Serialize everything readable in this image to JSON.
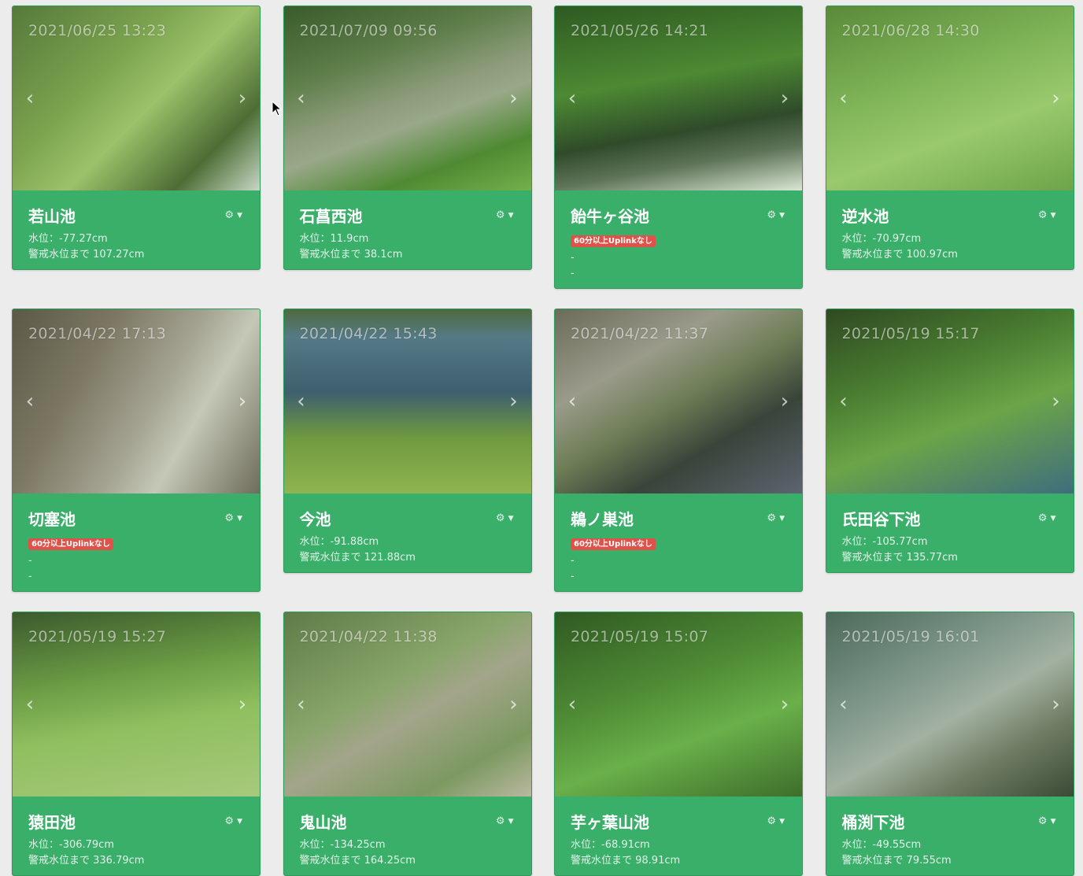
{
  "badge_text": "60分以上Uplinkなし",
  "cards": [
    {
      "name": "若山池",
      "timestamp": "2021/06/25 13:23",
      "line1": "水位：-77.27cm",
      "line2": "警戒水位まで 107.27cm",
      "badge": false,
      "bg": "linear-gradient(135deg,#557a3a 0%,#7aa24e 35%,#9cc26a 55%,#4d6d35 80%,#c7d7c5 100%)"
    },
    {
      "name": "石菖西池",
      "timestamp": "2021/07/09 09:56",
      "line1": "水位：11.9cm",
      "line2": "警戒水位まで 38.1cm",
      "badge": false,
      "bg": "linear-gradient(160deg,#385c2a 0%,#5e7e4a 30%,#8e9c7c 50%,#9aa88a 60%,#4f8a33 80%,#74b04b 100%)"
    },
    {
      "name": "飴牛ヶ谷池",
      "timestamp": "2021/05/26 14:21",
      "line1": "-",
      "line2": "-",
      "badge": true,
      "bg": "linear-gradient(170deg,#2e5a22 0%,#4d8a33 40%,#2f4b2a 65%,#5f7458 80%,#d9e6d4 100%)"
    },
    {
      "name": "逆水池",
      "timestamp": "2021/06/28 14:30",
      "line1": "水位：-70.97cm",
      "line2": "警戒水位まで 100.97cm",
      "badge": false,
      "bg": "linear-gradient(160deg,#5a8a3a 0%,#7fb457 40%,#9ac96d 65%,#6da449 100%)"
    },
    {
      "name": "切塞池",
      "timestamp": "2021/04/22 17:13",
      "line1": "-",
      "line2": "-",
      "badge": true,
      "bg": "linear-gradient(120deg,#5b5a47 0%,#7b7763 30%,#a4a391 55%,#c5c8b7 70%,#6e6c5a 100%)"
    },
    {
      "name": "今池",
      "timestamp": "2021/04/22 15:43",
      "line1": "水位：-91.88cm",
      "line2": "警戒水位まで 121.88cm",
      "badge": false,
      "bg": "linear-gradient(180deg,#4f6a3e 0%,#557a86 15%,#3e5f6e 45%,#6f9a3e 70%,#8fb451 100%)"
    },
    {
      "name": "鵜ノ巣池",
      "timestamp": "2021/04/22 11:37",
      "line1": "-",
      "line2": "-",
      "badge": true,
      "bg": "linear-gradient(150deg,#6b6b5a 0%,#9a9b8a 30%,#6e7d56 50%,#39443a 70%,#5d6470 100%)"
    },
    {
      "name": "氏田谷下池",
      "timestamp": "2021/05/19 15:17",
      "line1": "水位：-105.77cm",
      "line2": "警戒水位まで 135.77cm",
      "badge": false,
      "bg": "linear-gradient(160deg,#2f4a22 0%,#4a7d31 35%,#6ba548 60%,#3f6d7e 100%)"
    },
    {
      "name": "猿田池",
      "timestamp": "2021/05/19 15:27",
      "line1": "水位：-306.79cm",
      "line2": "警戒水位まで 336.79cm",
      "badge": false,
      "bg": "linear-gradient(170deg,#3b5a2d 0%,#6a9a44 35%,#8fbf5e 60%,#a7c97d 100%)"
    },
    {
      "name": "鬼山池",
      "timestamp": "2021/04/22 11:38",
      "line1": "水位：-134.25cm",
      "line2": "警戒水位まで 164.25cm",
      "badge": false,
      "bg": "linear-gradient(150deg,#5f7b48 0%,#88a56a 40%,#a3a58a 55%,#7c9960 80%,#b9b8a1 100%)"
    },
    {
      "name": "芋ヶ葉山池",
      "timestamp": "2021/05/19 15:07",
      "line1": "水位：-68.91cm",
      "line2": "警戒水位まで 98.91cm",
      "badge": false,
      "bg": "linear-gradient(160deg,#2f5a22 0%,#4f8b35 40%,#6ab04a 65%,#3d6e2a 100%)"
    },
    {
      "name": "桶渕下池",
      "timestamp": "2021/05/19 16:01",
      "line1": "水位：-49.55cm",
      "line2": "警戒水位まで 79.55cm",
      "badge": false,
      "bg": "linear-gradient(150deg,#4c6a5a 0%,#7e978a 35%,#a3b1a2 55%,#6f7d64 75%,#3b4a35 100%)"
    }
  ]
}
